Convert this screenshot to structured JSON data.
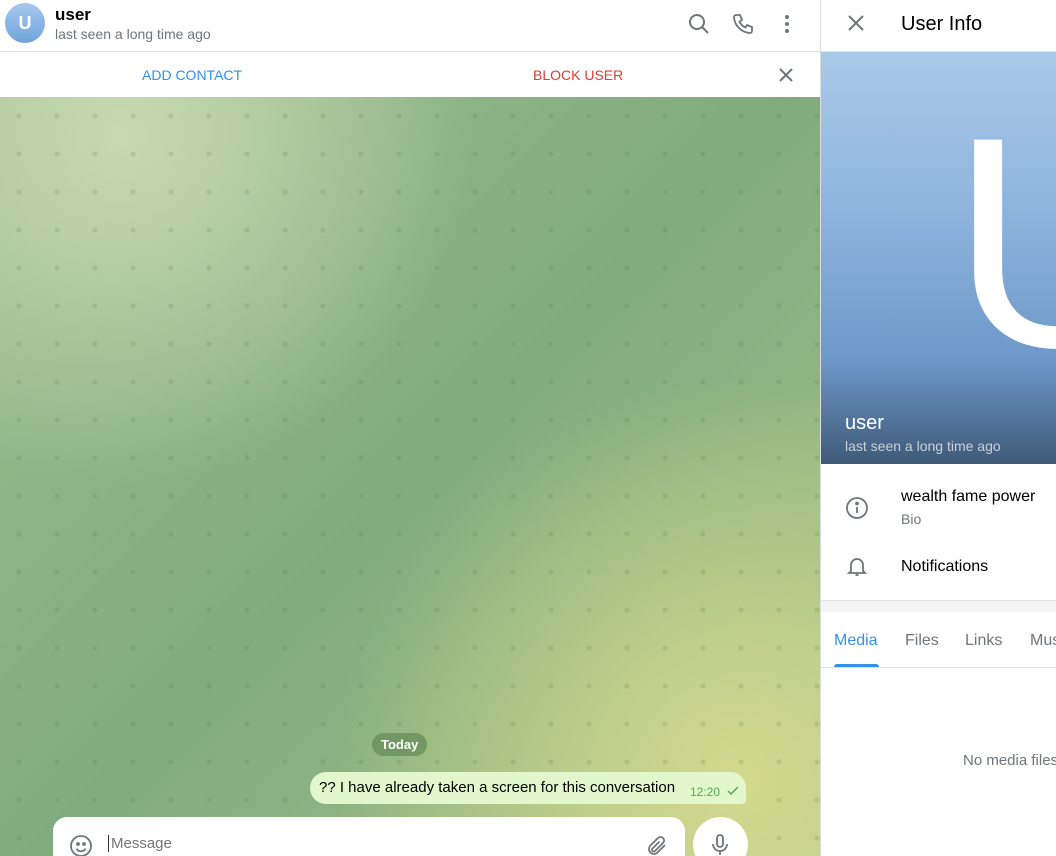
{
  "header": {
    "avatar_letter": "U",
    "name": "user",
    "status": "last seen a long time ago",
    "icons": [
      "search-icon",
      "phone-icon",
      "more-vertical-icon"
    ]
  },
  "action_bar": {
    "add_contact": "ADD CONTACT",
    "block_user": "BLOCK USER",
    "close_icon": "close-icon"
  },
  "chat": {
    "date_badge": "Today",
    "messages": [
      {
        "text": "?? I have already taken a screen for this conversation",
        "time": "12:20",
        "status": "sent"
      }
    ]
  },
  "composer": {
    "placeholder": "Message",
    "icons": [
      "emoji-icon",
      "attach-icon",
      "mic-icon"
    ]
  },
  "info_panel": {
    "title": "User Info",
    "avatar_letter": "U",
    "name": "user",
    "status": "last seen a long time ago",
    "bio": "wealth fame power",
    "bio_label": "Bio",
    "notifications": "Notifications",
    "tabs": [
      "Media",
      "Files",
      "Links",
      "Music"
    ],
    "active_tab": "Media",
    "empty_text": "No media files"
  },
  "colors": {
    "accent": "#3390ec",
    "danger": "#e53935",
    "bubble": "#e2f7cb"
  }
}
